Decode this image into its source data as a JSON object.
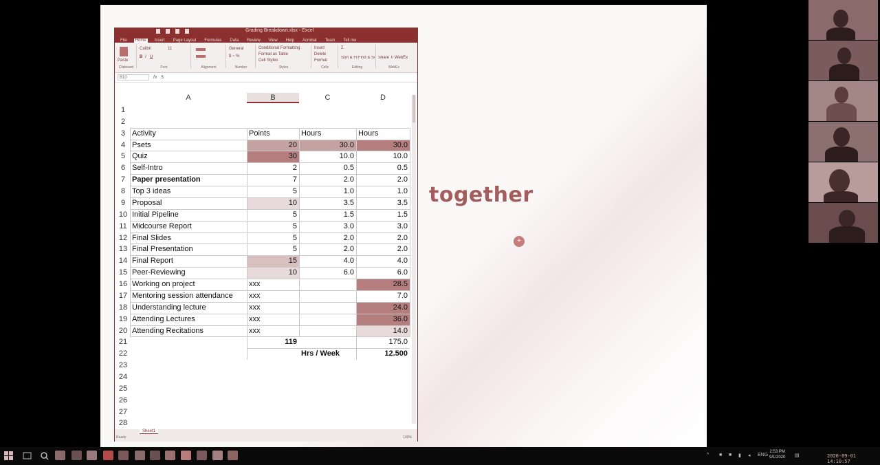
{
  "slide": {
    "visible_text": "together",
    "mark_glyph": "+"
  },
  "excel": {
    "window_title": "Grading Breakdown.xlsx - Excel",
    "ribbon_tabs": [
      "File",
      "Home",
      "Insert",
      "Page Layout",
      "Formulas",
      "Data",
      "Review",
      "View",
      "Help",
      "Acrobat",
      "Team",
      "Tell me"
    ],
    "active_tab": "Home",
    "ribbon": {
      "paste": "Paste",
      "font_name": "Calibri",
      "font_size": "11",
      "number_format": "General",
      "conditional_formatting": "Conditional Formatting",
      "format_as_table": "Format as Table",
      "cell_styles": "Cell Styles",
      "insert": "Insert",
      "delete": "Delete",
      "format": "Format",
      "sort_filter": "Sort & Filter",
      "find_select": "Find & Select",
      "share": "Share This File",
      "webex": "WebEx",
      "groups": [
        "Clipboard",
        "Font",
        "Alignment",
        "Number",
        "Styles",
        "Cells",
        "Editing",
        "WebEx"
      ]
    },
    "name_box": "B10",
    "formula_value": "5",
    "columns": [
      "A",
      "B",
      "C",
      "D"
    ],
    "selected_column": "B",
    "row_numbers": [
      "1",
      "2",
      "3",
      "4",
      "5",
      "6",
      "7",
      "8",
      "9",
      "10",
      "11",
      "12",
      "13",
      "14",
      "15",
      "16",
      "17",
      "18",
      "19",
      "20",
      "21",
      "22",
      "23",
      "24",
      "25",
      "26",
      "27",
      "28"
    ],
    "header": {
      "activity": "Activity",
      "points": "Points",
      "hours_c": "Hours",
      "hours_d": "Hours"
    },
    "rows": [
      {
        "a": "Psets",
        "b": "20",
        "c": "30.0",
        "d": "30.0",
        "hl_b": "#c4a2a2",
        "hl_c": "#c4a2a2",
        "hl_d": "#b47e7e"
      },
      {
        "a": "Quiz",
        "b": "30",
        "c": "10.0",
        "d": "10.0",
        "hl_b": "#b47e7e",
        "hl_c": "",
        "hl_d": ""
      },
      {
        "a": "Self-Intro",
        "b": "2",
        "c": "0.5",
        "d": "0.5",
        "hl_b": "",
        "hl_c": "",
        "hl_d": ""
      },
      {
        "a": "Paper presentation",
        "b": "7",
        "c": "2.0",
        "d": "2.0",
        "hl_b": "",
        "hl_c": "",
        "hl_d": "",
        "bold": true
      },
      {
        "a": "Top 3 ideas",
        "b": "5",
        "c": "1.0",
        "d": "1.0",
        "hl_b": "",
        "hl_c": "",
        "hl_d": ""
      },
      {
        "a": "Proposal",
        "b": "10",
        "c": "3.5",
        "d": "3.5",
        "hl_b": "#e8dada",
        "hl_c": "",
        "hl_d": ""
      },
      {
        "a": "Initial Pipeline",
        "b": "5",
        "c": "1.5",
        "d": "1.5",
        "hl_b": "",
        "hl_c": "",
        "hl_d": ""
      },
      {
        "a": "Midcourse Report",
        "b": "5",
        "c": "3.0",
        "d": "3.0",
        "hl_b": "",
        "hl_c": "",
        "hl_d": ""
      },
      {
        "a": "Final Slides",
        "b": "5",
        "c": "2.0",
        "d": "2.0",
        "hl_b": "",
        "hl_c": "",
        "hl_d": ""
      },
      {
        "a": "Final Presentation",
        "b": "5",
        "c": "2.0",
        "d": "2.0",
        "hl_b": "",
        "hl_c": "",
        "hl_d": ""
      },
      {
        "a": "Final Report",
        "b": "15",
        "c": "4.0",
        "d": "4.0",
        "hl_b": "#d8c0c0",
        "hl_c": "",
        "hl_d": ""
      },
      {
        "a": "Peer-Reviewing",
        "b": "10",
        "c": "6.0",
        "d": "6.0",
        "hl_b": "#e8dada",
        "hl_c": "",
        "hl_d": ""
      },
      {
        "a": "Working on project",
        "b": "xxx",
        "c": "",
        "d": "28.5",
        "hl_b": "",
        "hl_c": "",
        "hl_d": "#b47e7e"
      },
      {
        "a": "Mentoring session attendance",
        "b": "xxx",
        "c": "",
        "d": "7.0",
        "hl_b": "",
        "hl_c": "",
        "hl_d": ""
      },
      {
        "a": "Understanding lecture",
        "b": "xxx",
        "c": "",
        "d": "24.0",
        "hl_b": "",
        "hl_c": "",
        "hl_d": "#b47e7e"
      },
      {
        "a": "Attending Lectures",
        "b": "xxx",
        "c": "",
        "d": "36.0",
        "hl_b": "",
        "hl_c": "",
        "hl_d": "#b47e7e"
      },
      {
        "a": "Attending Recitations",
        "b": "xxx",
        "c": "",
        "d": "14.0",
        "hl_b": "",
        "hl_c": "",
        "hl_d": "#e8dada"
      }
    ],
    "total_points": "119",
    "total_hours": "175.0",
    "per_week_label": "Hrs / Week",
    "per_week_value": "12.500",
    "sheet_tab": "Sheet1",
    "status": "Ready",
    "zoom": "100%"
  },
  "taskbar": {
    "tray": [
      "ENG"
    ],
    "clock_time": "2:53 PM",
    "clock_date": "9/1/2020",
    "timestamp": "2020-09-01 14:10:57"
  },
  "colors": {
    "accent": "#8b2f2f",
    "highlight_dark": "#b47e7e",
    "slide_title": "#a35d5d"
  }
}
